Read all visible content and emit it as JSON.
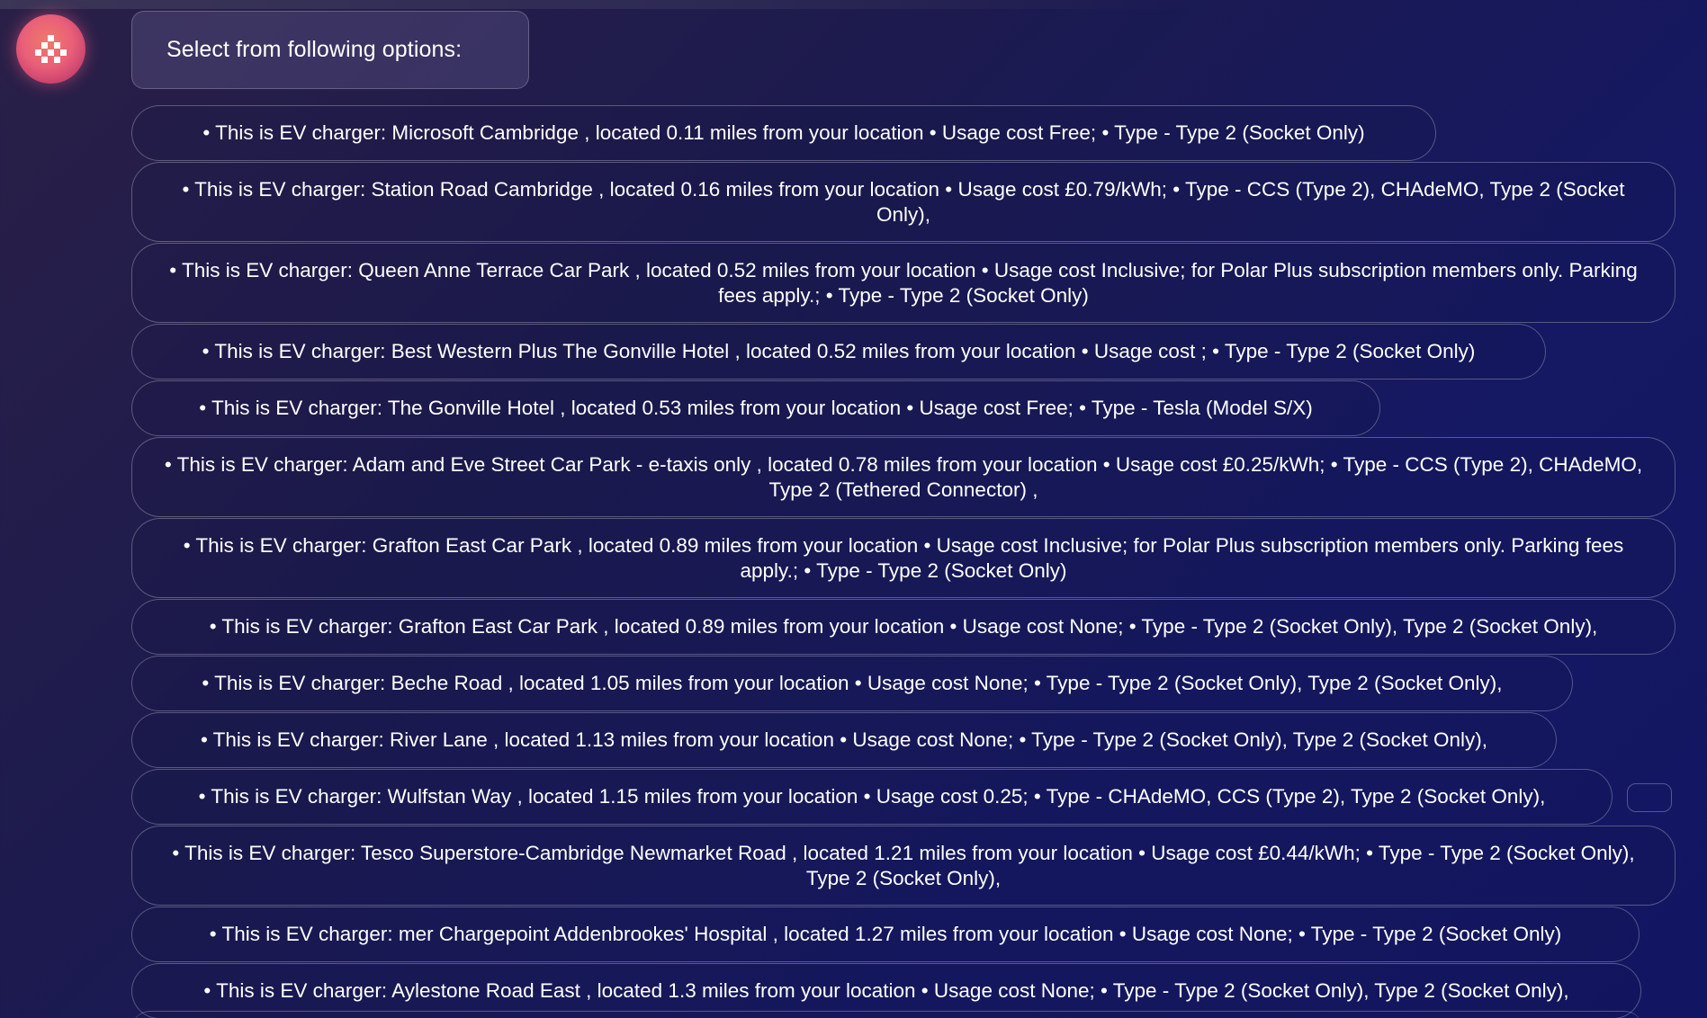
{
  "assistant": {
    "avatar_icon": "assistant-logo-icon",
    "accent": "#e95f78"
  },
  "prompt": {
    "text": "Select from following options:"
  },
  "options": [
    {
      "text": "• This is EV charger: Microsoft Cambridge , located 0.11 miles from your location • Usage cost Free; • Type - Type 2 (Socket Only)"
    },
    {
      "text": "• This is EV charger: Station Road Cambridge , located 0.16 miles from your location • Usage cost £0.79/kWh; • Type - CCS (Type 2), CHAdeMO, Type 2 (Socket Only),"
    },
    {
      "text": "• This is EV charger: Queen Anne Terrace Car Park , located 0.52 miles from your location • Usage cost Inclusive; for Polar Plus subscription members only. Parking fees apply.; • Type - Type 2 (Socket Only)"
    },
    {
      "text": "• This is EV charger: Best Western Plus The Gonville Hotel , located 0.52 miles from your location • Usage cost ; • Type - Type 2 (Socket Only)"
    },
    {
      "text": "• This is EV charger: The Gonville Hotel , located 0.53 miles from your location • Usage cost Free; • Type - Tesla (Model S/X)"
    },
    {
      "text": "• This is EV charger: Adam and Eve Street Car Park - e-taxis only , located 0.78 miles from your location • Usage cost £0.25/kWh; • Type - CCS (Type 2), CHAdeMO, Type 2 (Tethered Connector) ,"
    },
    {
      "text": "• This is EV charger: Grafton East Car Park , located 0.89 miles from your location • Usage cost Inclusive; for Polar Plus subscription members only. Parking fees apply.; • Type - Type 2 (Socket Only)"
    },
    {
      "text": "• This is EV charger: Grafton East Car Park , located 0.89 miles from your location • Usage cost None; • Type - Type 2 (Socket Only), Type 2 (Socket Only),"
    },
    {
      "text": "• This is EV charger: Beche Road , located 1.05 miles from your location • Usage cost None; • Type - Type 2 (Socket Only), Type 2 (Socket Only),"
    },
    {
      "text": "• This is EV charger: River Lane , located 1.13 miles from your location • Usage cost None; • Type - Type 2 (Socket Only), Type 2 (Socket Only),"
    },
    {
      "text": "• This is EV charger: Wulfstan Way , located 1.15 miles from your location • Usage cost 0.25; • Type - CHAdeMO, CCS (Type 2), Type 2 (Socket Only),"
    },
    {
      "text": "• This is EV charger: Tesco Superstore-Cambridge Newmarket Road , located 1.21 miles from your location • Usage cost £0.44/kWh; • Type - Type 2 (Socket Only), Type 2 (Socket Only),"
    },
    {
      "text": "• This is EV charger: mer Chargepoint Addenbrookes' Hospital , located 1.27 miles from your location • Usage cost None; • Type - Type 2 (Socket Only)"
    },
    {
      "text": "• This is EV charger: Aylestone Road East , located 1.3 miles from your location • Usage cost None; • Type - Type 2 (Socket Only), Type 2 (Socket Only),"
    }
  ]
}
